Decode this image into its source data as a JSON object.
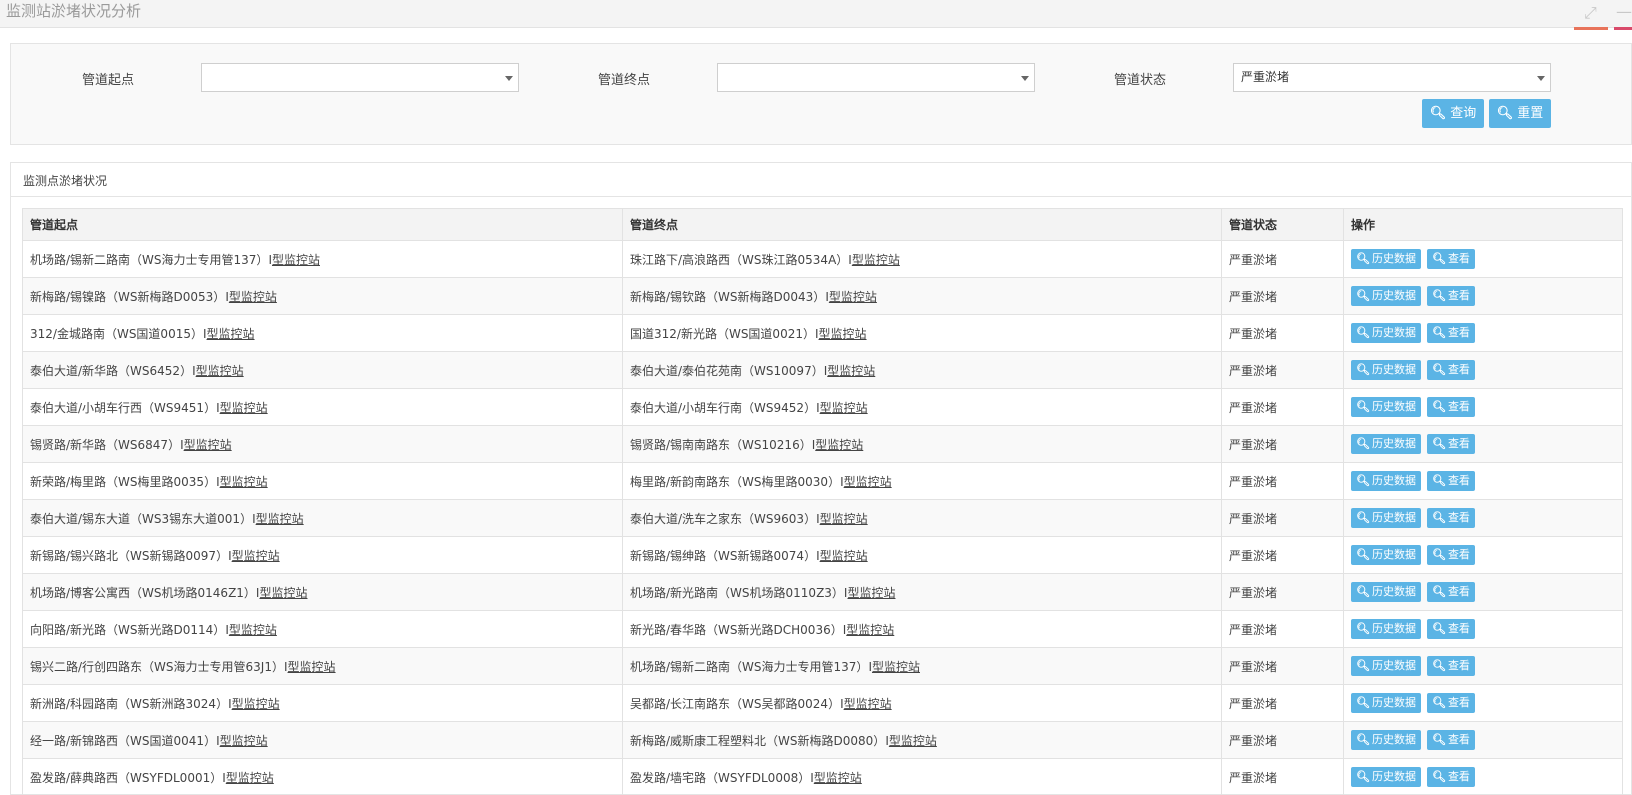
{
  "window": {
    "title": "监测站淤堵状况分析",
    "expand_icon": "expand-icon",
    "minimize_icon": "minimize-icon"
  },
  "filters": {
    "start_label": "管道起点",
    "start_value": "",
    "end_label": "管道终点",
    "end_value": "",
    "status_label": "管道状态",
    "status_value": "严重淤堵",
    "search_label": "查询",
    "reset_label": "重置",
    "search_icon": "search-icon"
  },
  "result": {
    "panel_title": "监测点淤堵状况",
    "columns": [
      "管道起点",
      "管道终点",
      "管道状态",
      "操作"
    ],
    "history_label": "历史数据",
    "view_label": "查看",
    "rows": [
      {
        "start": "机场路/锡新二路南（WS海力士专用管137）",
        "end": "珠江路下/高浪路西（WS珠江路0534A）",
        "status": "严重淤堵"
      },
      {
        "start": "新梅路/锡镍路（WS新梅路D0053）",
        "end": "新梅路/锡钦路（WS新梅路D0043）",
        "status": "严重淤堵"
      },
      {
        "start": "312/金城路南（WS国道0015）",
        "end": "国道312/新光路（WS国道0021）",
        "status": "严重淤堵"
      },
      {
        "start": "泰伯大道/新华路（WS6452）",
        "end": "泰伯大道/泰伯花苑南（WS10097）",
        "status": "严重淤堵"
      },
      {
        "start": "泰伯大道/小胡车行西（WS9451）",
        "end": "泰伯大道/小胡车行南（WS9452）",
        "status": "严重淤堵"
      },
      {
        "start": "锡贤路/新华路（WS6847）",
        "end": "锡贤路/锡南南路东（WS10216）",
        "status": "严重淤堵"
      },
      {
        "start": "新荣路/梅里路（WS梅里路0035）",
        "end": "梅里路/新韵南路东（WS梅里路0030）",
        "status": "严重淤堵"
      },
      {
        "start": "泰伯大道/锡东大道（WS3锡东大道001）",
        "end": "泰伯大道/洗车之家东（WS9603）",
        "status": "严重淤堵"
      },
      {
        "start": "新锡路/锡兴路北（WS新锡路0097）",
        "end": "新锡路/锡绅路（WS新锡路0074）",
        "status": "严重淤堵"
      },
      {
        "start": "机场路/博客公寓西（WS机场路0146Z1）",
        "end": "机场路/新光路南（WS机场路0110Z3）",
        "status": "严重淤堵"
      },
      {
        "start": "向阳路/新光路（WS新光路D0114）",
        "end": "新光路/春华路（WS新光路DCH0036）",
        "status": "严重淤堵"
      },
      {
        "start": "锡兴二路/行创四路东（WS海力士专用管63J1）",
        "end": "机场路/锡新二路南（WS海力士专用管137）",
        "status": "严重淤堵"
      },
      {
        "start": "新洲路/科园路南（WS新洲路3024）",
        "end": "吴都路/长江南路东（WS吴都路0024）",
        "status": "严重淤堵"
      },
      {
        "start": "经一路/新锦路西（WS国道0041）",
        "end": "新梅路/威斯康工程塑料北（WS新梅路D0080）",
        "status": "严重淤堵"
      },
      {
        "start": "盈发路/薛典路西（WSYFDL0001）",
        "end": "盈发路/墙宅路（WSYFDL0008）",
        "status": "严重淤堵"
      }
    ],
    "station_suffix_prefix": "I",
    "station_suffix": "型监控站"
  }
}
